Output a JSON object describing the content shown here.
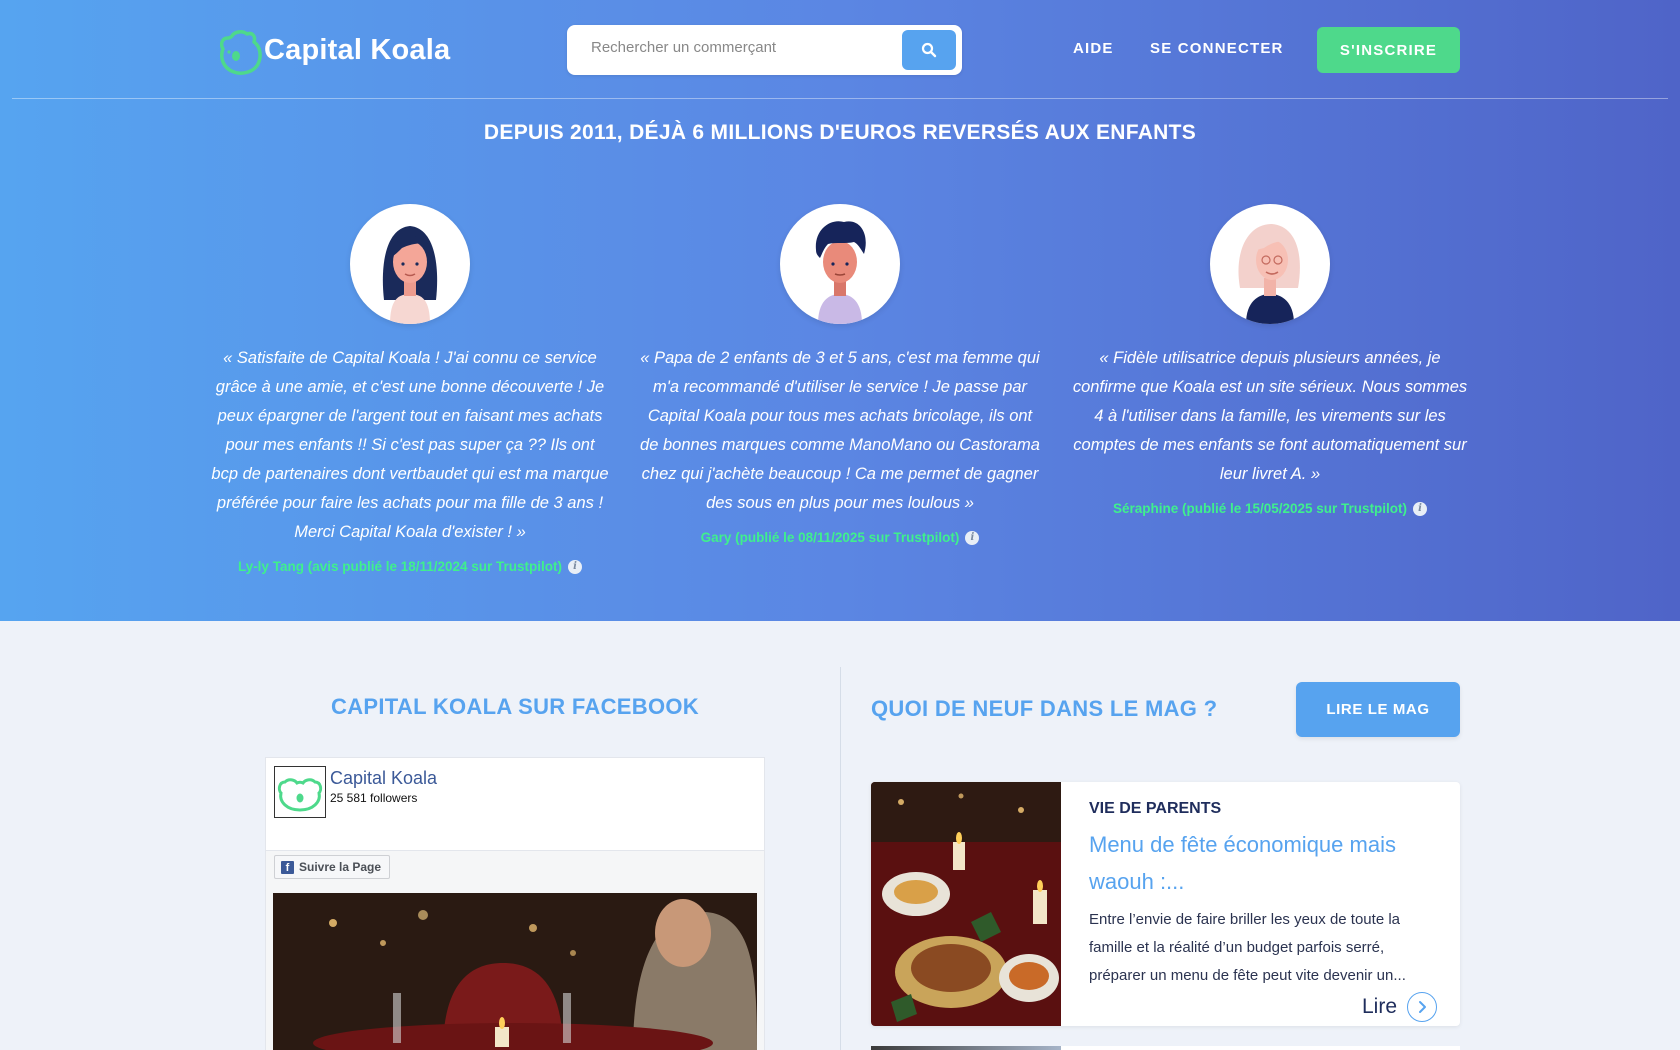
{
  "header": {
    "logo_text": "Capital Koala",
    "search_placeholder": "Rechercher un commerçant",
    "nav_help": "AIDE",
    "nav_login": "SE CONNECTER",
    "nav_signup": "S'INSCRIRE"
  },
  "hero": {
    "title": "DEPUIS 2011, DÉJÀ 6 MILLIONS D'EUROS REVERSÉS AUX ENFANTS",
    "testimonials": [
      {
        "quote": "« Satisfaite de Capital Koala ! J'ai connu ce service grâce à une amie, et c'est une bonne découverte ! Je peux épargner de l'argent tout en faisant mes achats pour mes enfants !! Si c'est pas super ça ?? Ils ont bcp de partenaires dont vertbaudet qui est ma marque préférée pour faire les achats pour ma fille de 3 ans ! Merci Capital Koala d'exister ! »",
        "author": "Ly-ly Tang (avis publié le 18/11/2024 sur Trustpilot)"
      },
      {
        "quote": "« Papa de 2 enfants de 3 et 5 ans, c'est ma femme qui m'a recommandé d'utiliser le service ! Je passe par Capital Koala pour tous mes achats bricolage, ils ont de bonnes marques comme ManoMano ou Castorama chez qui j'achète beaucoup ! Ca me permet de gagner des sous en plus pour mes loulous »",
        "author": "Gary (publié le 08/11/2025 sur Trustpilot)"
      },
      {
        "quote": "« Fidèle utilisatrice depuis plusieurs années, je confirme que Koala est un site sérieux. Nous sommes 4 à l'utiliser dans la famille, les virements sur les comptes de mes enfants se font automatiquement sur leur livret A. »",
        "author": "Séraphine (publié le 15/05/2025 sur Trustpilot)"
      }
    ]
  },
  "facebook": {
    "section_title": "CAPITAL KOALA SUR FACEBOOK",
    "page_name": "Capital Koala",
    "followers": "25 581 followers",
    "follow_label": "Suivre la Page"
  },
  "mag": {
    "section_title": "QUOI DE NEUF DANS LE MAG ?",
    "read_mag_label": "LIRE LE MAG",
    "article": {
      "category": "VIE DE PARENTS",
      "title": "Menu de fête économique mais waouh :...",
      "excerpt": "Entre l’envie de faire briller les yeux de toute la famille et la réalité d’un budget parfois serré, préparer un menu de fête peut vite devenir un...",
      "read_label": "Lire"
    }
  },
  "colors": {
    "brand_blue": "#57a3ef",
    "brand_green": "#4ed98b",
    "dark_navy": "#1f2d5c"
  }
}
